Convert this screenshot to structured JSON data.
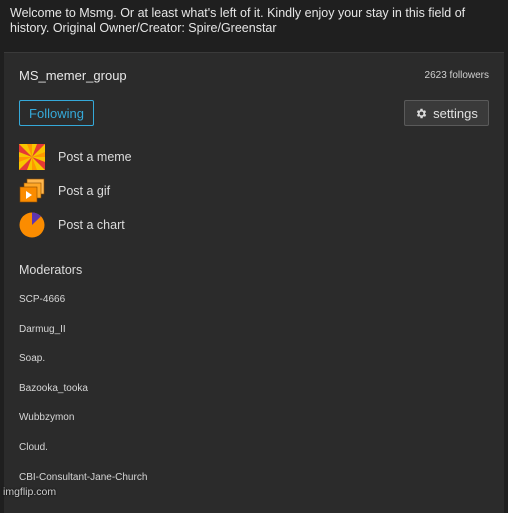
{
  "description": "Welcome to Msmg. Or at least what's left of it. Kindly enjoy your stay in this field of history. Original Owner/Creator: Spire/Greenstar",
  "group": {
    "name": "MS_memer_group",
    "followers": "2623 followers"
  },
  "buttons": {
    "following": "Following",
    "settings": "settings",
    "settings_icon": "gear-icon"
  },
  "actions": [
    {
      "label": "Post a meme",
      "icon": "meme-icon"
    },
    {
      "label": "Post a gif",
      "icon": "gif-icon"
    },
    {
      "label": "Post a chart",
      "icon": "chart-icon"
    }
  ],
  "moderators": {
    "title": "Moderators",
    "list": [
      "SCP-4666",
      "Darmug_II",
      "Soap.",
      "Bazooka_tooka",
      "Wubbzymon",
      "Cloud.",
      "CBI-Consultant-Jane-Church"
    ]
  },
  "watermark": "imgflip.com",
  "colors": {
    "accent": "#35a9d9",
    "background": "#1f1f1f",
    "panel": "#2b2b2b"
  }
}
